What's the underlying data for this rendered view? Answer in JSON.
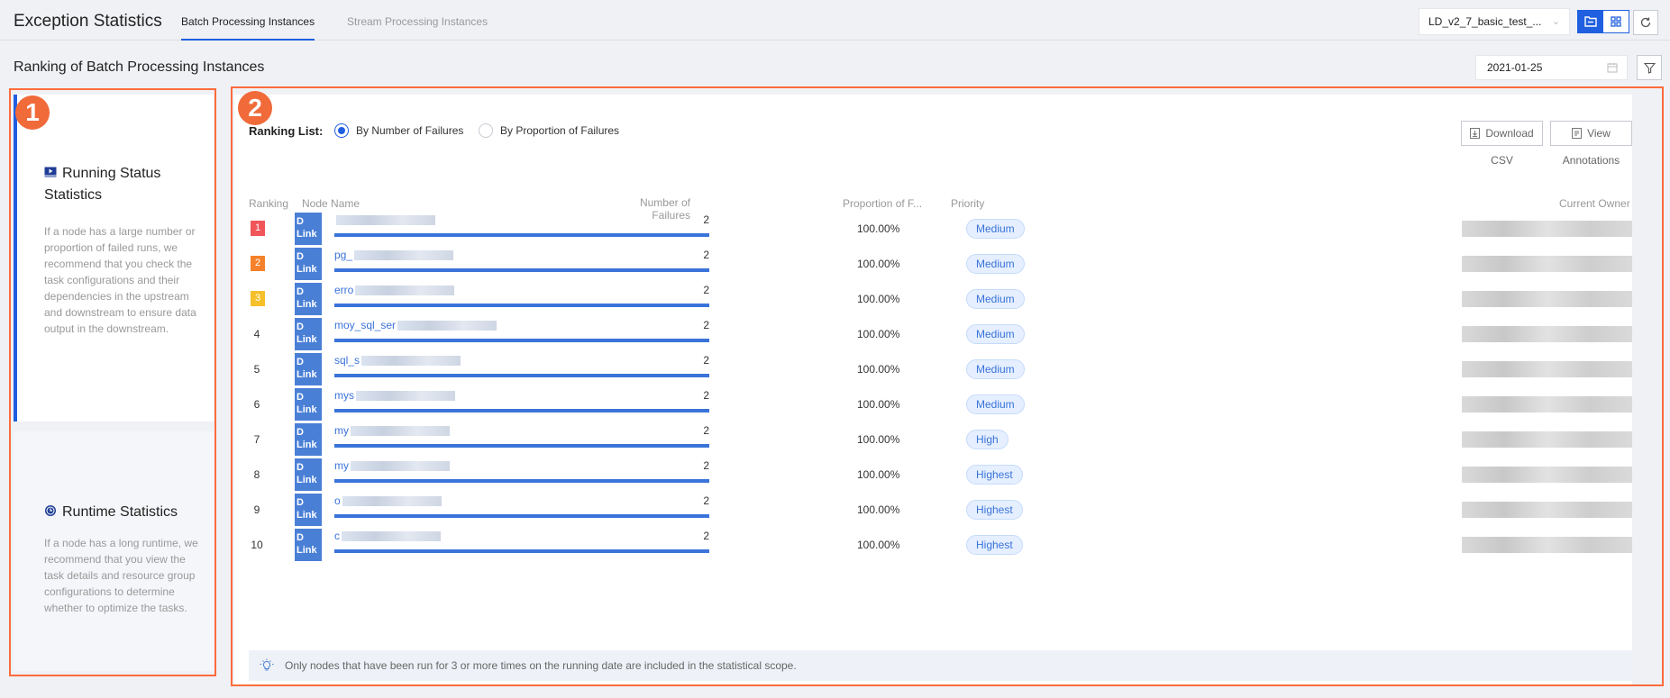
{
  "app": {
    "title": "Exception Statistics",
    "tabs": [
      {
        "label": "Batch Processing Instances",
        "active": true
      },
      {
        "label": "Stream Processing Instances",
        "active": false
      }
    ],
    "project": "LD_v2_7_basic_test_...",
    "accent_color": "#1f5fe0"
  },
  "section": {
    "title": "Ranking of Batch Processing Instances",
    "date": "2021-01-25"
  },
  "cards": [
    {
      "title": "Running Status Statistics",
      "icon": "play-icon",
      "description": "If a node has a large number or proportion of failed runs, we recommend that you check the task configurations and their dependencies in the upstream and downstream to ensure data output in the downstream.",
      "active": true
    },
    {
      "title": "Runtime Statistics",
      "icon": "clock-icon",
      "description": "If a node has a long runtime, we recommend that you view the task details and resource group configurations to determine whether to optimize the tasks.",
      "active": false
    }
  ],
  "ranking": {
    "label": "Ranking List:",
    "options": [
      {
        "label": "By Number of Failures",
        "checked": true
      },
      {
        "label": "By Proportion of Failures",
        "checked": false
      }
    ],
    "download": {
      "label": "Download",
      "sub": "CSV"
    },
    "view": {
      "label": "View",
      "sub": "Annotations"
    }
  },
  "table": {
    "headers": {
      "rank": "Ranking",
      "node": "Node Name",
      "failures": "Number of Failures",
      "proportion": "Proportion of F...",
      "priority": "Priority",
      "owner": "Current Owner"
    },
    "logo_text": "D Link",
    "rows": [
      {
        "rank": "1",
        "name": "",
        "failures": "2",
        "proportion": "100.00%",
        "priority": "Medium"
      },
      {
        "rank": "2",
        "name": "pg_",
        "failures": "2",
        "proportion": "100.00%",
        "priority": "Medium"
      },
      {
        "rank": "3",
        "name": "erro",
        "failures": "2",
        "proportion": "100.00%",
        "priority": "Medium"
      },
      {
        "rank": "4",
        "name": "moy_sql_ser",
        "failures": "2",
        "proportion": "100.00%",
        "priority": "Medium"
      },
      {
        "rank": "5",
        "name": "sql_s",
        "failures": "2",
        "proportion": "100.00%",
        "priority": "Medium"
      },
      {
        "rank": "6",
        "name": "mys",
        "failures": "2",
        "proportion": "100.00%",
        "priority": "Medium"
      },
      {
        "rank": "7",
        "name": "my",
        "failures": "2",
        "proportion": "100.00%",
        "priority": "High"
      },
      {
        "rank": "8",
        "name": "my",
        "failures": "2",
        "proportion": "100.00%",
        "priority": "Highest"
      },
      {
        "rank": "9",
        "name": "o",
        "failures": "2",
        "proportion": "100.00%",
        "priority": "Highest"
      },
      {
        "rank": "10",
        "name": "c",
        "failures": "2",
        "proportion": "100.00%",
        "priority": "Highest"
      }
    ],
    "badge_colors": [
      "#f0555a",
      "#f5822a",
      "#f5c02a"
    ]
  },
  "note": "Only nodes that have been run for 3 or more times on the running date are included in the statistical scope.",
  "markers": [
    "1",
    "2"
  ]
}
